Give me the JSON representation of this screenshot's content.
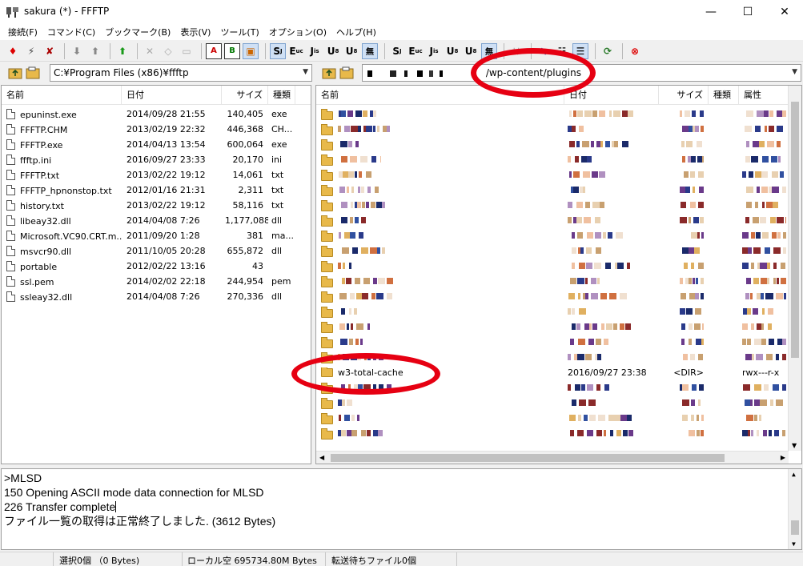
{
  "window": {
    "title": "sakura (*) - FFFTP",
    "minimize": "—",
    "maximize": "☐",
    "close": "✕"
  },
  "menu": [
    "接続(F)",
    "コマンド(C)",
    "ブックマーク(B)",
    "表示(V)",
    "ツール(T)",
    "オプション(O)",
    "ヘルプ(H)"
  ],
  "local": {
    "path": "C:¥Program Files (x86)¥ffftp",
    "columns": [
      "名前",
      "日付",
      "サイズ",
      "種類"
    ],
    "files": [
      {
        "name": "epuninst.exe",
        "date": "2014/09/28 21:55",
        "size": "140,405",
        "type": "exe"
      },
      {
        "name": "FFFTP.CHM",
        "date": "2013/02/19 22:32",
        "size": "446,368",
        "type": "CH..."
      },
      {
        "name": "FFFTP.exe",
        "date": "2014/04/13 13:54",
        "size": "600,064",
        "type": "exe"
      },
      {
        "name": "ffftp.ini",
        "date": "2016/09/27 23:33",
        "size": "20,170",
        "type": "ini"
      },
      {
        "name": "FFFTP.txt",
        "date": "2013/02/22 19:12",
        "size": "14,061",
        "type": "txt"
      },
      {
        "name": "FFFTP_hpnonstop.txt",
        "date": "2012/01/16 21:31",
        "size": "2,311",
        "type": "txt"
      },
      {
        "name": "history.txt",
        "date": "2013/02/22 19:12",
        "size": "58,116",
        "type": "txt"
      },
      {
        "name": "libeay32.dll",
        "date": "2014/04/08 7:26",
        "size": "1,177,088",
        "type": "dll"
      },
      {
        "name": "Microsoft.VC90.CRT.m...",
        "date": "2011/09/20 1:28",
        "size": "381",
        "type": "ma..."
      },
      {
        "name": "msvcr90.dll",
        "date": "2011/10/05 20:28",
        "size": "655,872",
        "type": "dll"
      },
      {
        "name": "portable",
        "date": "2012/02/22 13:16",
        "size": "43",
        "type": ""
      },
      {
        "name": "ssl.pem",
        "date": "2014/02/02 22:18",
        "size": "244,954",
        "type": "pem"
      },
      {
        "name": "ssleay32.dll",
        "date": "2014/04/08 7:26",
        "size": "270,336",
        "type": "dll"
      }
    ]
  },
  "remote": {
    "path": "/wp-content/plugins",
    "columns": [
      "名前",
      "日付",
      "サイズ",
      "種類",
      "属性"
    ],
    "visible_row": {
      "name": "w3-total-cache",
      "date": "2016/09/27 23:38",
      "size": "<DIR>",
      "attr": "rwx---r-x"
    }
  },
  "log": [
    ">MLSD",
    "150 Opening ASCII mode data connection for MLSD",
    "226 Transfer complete",
    "ファイル一覧の取得は正常終了しました. (3612 Bytes)"
  ],
  "status": {
    "selection": "選択0個 （0 Bytes)",
    "local_free": "ローカル空 695734.80M Bytes",
    "queue": "転送待ちファイル0個"
  },
  "colors": {
    "highlight": "#e60012",
    "folder": "#e8b94a"
  }
}
